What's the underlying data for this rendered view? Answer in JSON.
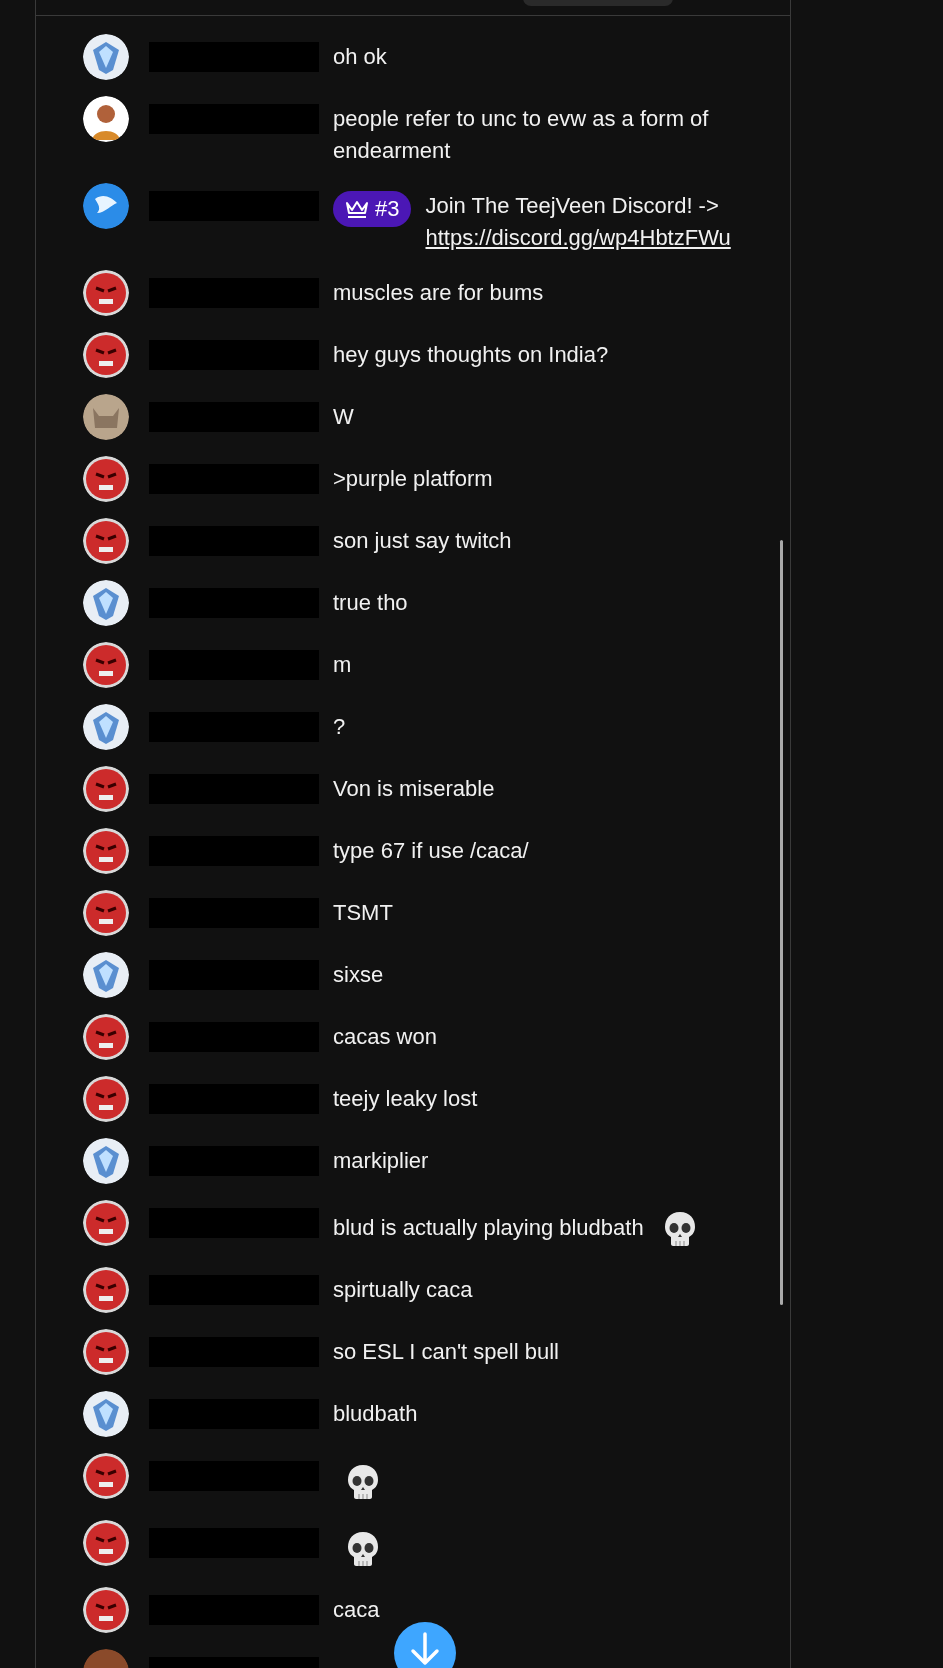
{
  "messages": [
    {
      "avatar": {
        "kind": "crystal"
      },
      "parts": [
        {
          "kind": "text",
          "text": "oh ok"
        }
      ]
    },
    {
      "avatar": {
        "kind": "person"
      },
      "parts": [
        {
          "kind": "text",
          "text": "people refer to unc to evw as a form of endearment"
        }
      ]
    },
    {
      "avatar": {
        "kind": "globe"
      },
      "badge": "#3",
      "parts": [
        {
          "kind": "text",
          "text": "Join The TeejVeen Discord! ->"
        },
        {
          "kind": "link",
          "text": "https://discord.gg/wp4HbtzFWu"
        }
      ]
    },
    {
      "avatar": {
        "kind": "red"
      },
      "parts": [
        {
          "kind": "text",
          "text": "muscles are for bums"
        }
      ]
    },
    {
      "avatar": {
        "kind": "red"
      },
      "parts": [
        {
          "kind": "text",
          "text": "hey guys thoughts on India?"
        }
      ]
    },
    {
      "avatar": {
        "kind": "cat"
      },
      "parts": [
        {
          "kind": "text",
          "text": "W"
        }
      ]
    },
    {
      "avatar": {
        "kind": "red"
      },
      "parts": [
        {
          "kind": "text",
          "text": ">purple platform"
        }
      ]
    },
    {
      "avatar": {
        "kind": "red"
      },
      "parts": [
        {
          "kind": "text",
          "text": "son just say twitch"
        }
      ]
    },
    {
      "avatar": {
        "kind": "crystal"
      },
      "parts": [
        {
          "kind": "text",
          "text": "true tho"
        }
      ]
    },
    {
      "avatar": {
        "kind": "red"
      },
      "parts": [
        {
          "kind": "text",
          "text": "m"
        }
      ]
    },
    {
      "avatar": {
        "kind": "crystal"
      },
      "parts": [
        {
          "kind": "text",
          "text": "?"
        }
      ]
    },
    {
      "avatar": {
        "kind": "red"
      },
      "parts": [
        {
          "kind": "text",
          "text": "Von is miserable"
        }
      ]
    },
    {
      "avatar": {
        "kind": "red"
      },
      "parts": [
        {
          "kind": "text",
          "text": "type 67 if use /caca/"
        }
      ]
    },
    {
      "avatar": {
        "kind": "red"
      },
      "parts": [
        {
          "kind": "text",
          "text": "TSMT"
        }
      ]
    },
    {
      "avatar": {
        "kind": "crystal"
      },
      "parts": [
        {
          "kind": "text",
          "text": "sixse"
        }
      ]
    },
    {
      "avatar": {
        "kind": "red"
      },
      "parts": [
        {
          "kind": "text",
          "text": "cacas won"
        }
      ]
    },
    {
      "avatar": {
        "kind": "red"
      },
      "parts": [
        {
          "kind": "text",
          "text": "teejy leaky lost"
        }
      ]
    },
    {
      "avatar": {
        "kind": "crystal"
      },
      "parts": [
        {
          "kind": "text",
          "text": "markiplier"
        }
      ]
    },
    {
      "avatar": {
        "kind": "red"
      },
      "parts": [
        {
          "kind": "text",
          "text": "blud is actually playing bludbath"
        },
        {
          "kind": "emoji"
        }
      ]
    },
    {
      "avatar": {
        "kind": "red"
      },
      "parts": [
        {
          "kind": "text",
          "text": "spirtually caca"
        }
      ]
    },
    {
      "avatar": {
        "kind": "red"
      },
      "parts": [
        {
          "kind": "text",
          "text": "so ESL I can't spell bull"
        }
      ]
    },
    {
      "avatar": {
        "kind": "crystal"
      },
      "parts": [
        {
          "kind": "text",
          "text": "bludbath"
        }
      ]
    },
    {
      "avatar": {
        "kind": "red"
      },
      "parts": [
        {
          "kind": "emoji"
        }
      ]
    },
    {
      "avatar": {
        "kind": "red"
      },
      "parts": [
        {
          "kind": "emoji"
        }
      ]
    },
    {
      "avatar": {
        "kind": "red"
      },
      "parts": [
        {
          "kind": "text",
          "text": "caca"
        }
      ]
    },
    {
      "avatar": {
        "kind": "brown"
      }
    }
  ]
}
